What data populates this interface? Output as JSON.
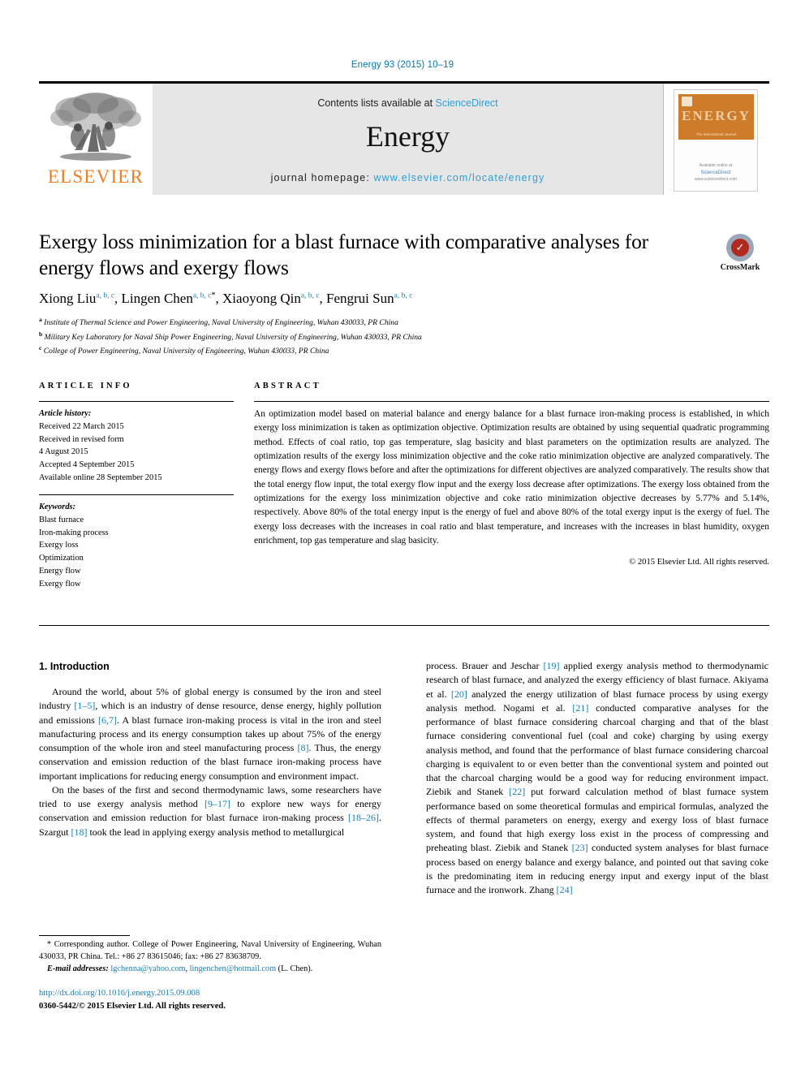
{
  "running_head": "Energy 93 (2015) 10–19",
  "masthead": {
    "publisher_name": "ELSEVIER",
    "contents_prefix": "Contents lists available at ",
    "contents_link": "ScienceDirect",
    "journal_title": "Energy",
    "homepage_prefix": "journal homepage: ",
    "homepage_url": "www.elsevier.com/locate/energy",
    "cover": {
      "title": "ENERGY",
      "subtitle": "The International Journal",
      "footer_line1": "Available online at",
      "footer_line2": "ScienceDirect",
      "footer_line3": "www.sciencedirect.com"
    }
  },
  "article": {
    "title": "Exergy loss minimization for a blast furnace with comparative analyses for energy flows and exergy flows",
    "authors": [
      {
        "name": "Xiong Liu",
        "marks": "a, b, c",
        "corresponding": false
      },
      {
        "name": "Lingen Chen",
        "marks": "a, b, c",
        "corresponding": true
      },
      {
        "name": "Xiaoyong Qin",
        "marks": "a, b, c",
        "corresponding": false
      },
      {
        "name": "Fengrui Sun",
        "marks": "a, b, c",
        "corresponding": false
      }
    ],
    "affiliations": [
      {
        "mark": "a",
        "text": "Institute of Thermal Science and Power Engineering, Naval University of Engineering, Wuhan 430033, PR China"
      },
      {
        "mark": "b",
        "text": "Military Key Laboratory for Naval Ship Power Engineering, Naval University of Engineering, Wuhan 430033, PR China"
      },
      {
        "mark": "c",
        "text": "College of Power Engineering, Naval University of Engineering, Wuhan 430033, PR China"
      }
    ]
  },
  "crossmark": {
    "label": "CrossMark"
  },
  "sections": {
    "article_info_header": "ARTICLE INFO",
    "abstract_header": "ABSTRACT"
  },
  "article_info": {
    "history_label": "Article history:",
    "history": [
      "Received 22 March 2015",
      "Received in revised form",
      "4 August 2015",
      "Accepted 4 September 2015",
      "Available online 28 September 2015"
    ],
    "keywords_label": "Keywords:",
    "keywords": [
      "Blast furnace",
      "Iron-making process",
      "Exergy loss",
      "Optimization",
      "Energy flow",
      "Exergy flow"
    ]
  },
  "abstract": {
    "text": "An optimization model based on material balance and energy balance for a blast furnace iron-making process is established, in which exergy loss minimization is taken as optimization objective. Optimization results are obtained by using sequential quadratic programming method. Effects of coal ratio, top gas temperature, slag basicity and blast parameters on the optimization results are analyzed. The optimization results of the exergy loss minimization objective and the coke ratio minimization objective are analyzed comparatively. The energy flows and exergy flows before and after the optimizations for different objectives are analyzed comparatively. The results show that the total energy flow input, the total exergy flow input and the exergy loss decrease after optimizations. The exergy loss obtained from the optimizations for the exergy loss minimization objective and coke ratio minimization objective decreases by 5.77% and 5.14%, respectively. Above 80% of the total energy input is the energy of fuel and above 80% of the total exergy input is the exergy of fuel. The exergy loss decreases with the increases in coal ratio and blast temperature, and increases with the increases in blast humidity, oxygen enrichment, top gas temperature and slag basicity.",
    "copyright": "© 2015 Elsevier Ltd. All rights reserved."
  },
  "body": {
    "section_number_title": "1. Introduction",
    "left_paragraph_1": {
      "part1": "Around the world, about 5% of global energy is consumed by the iron and steel industry ",
      "ref1": "[1–5]",
      "part2": ", which is an industry of dense resource, dense energy, highly pollution and emissions ",
      "ref2": "[6,7]",
      "part3": ". A blast furnace iron-making process is vital in the iron and steel manufacturing process and its energy consumption takes up about 75% of the energy consumption of the whole iron and steel manufacturing process ",
      "ref3": "[8]",
      "part4": ". Thus, the energy conservation and emission reduction of the blast furnace iron-making process have important implications for reducing energy consumption and environment impact."
    },
    "left_paragraph_2": {
      "part1": "On the bases of the first and second thermodynamic laws, some researchers have tried to use exergy analysis method ",
      "ref1": "[9–17]",
      "part2": " to explore new ways for energy conservation and emission reduction for blast furnace iron-making process ",
      "ref2": "[18–26]",
      "part3": ". Szargut ",
      "ref3": "[18]",
      "part4": " took the lead in applying exergy analysis method to metallurgical"
    },
    "right_paragraph": {
      "part1": "process. Brauer and Jeschar ",
      "ref1": "[19]",
      "part2": " applied exergy analysis method to thermodynamic research of blast furnace, and analyzed the exergy efficiency of blast furnace. Akiyama et al. ",
      "ref2": "[20]",
      "part3": " analyzed the energy utilization of blast furnace process by using exergy analysis method. Nogami et al. ",
      "ref3": "[21]",
      "part4": " conducted comparative analyses for the performance of blast furnace considering charcoal charging and that of the blast furnace considering conventional fuel (coal and coke) charging by using exergy analysis method, and found that the performance of blast furnace considering charcoal charging is equivalent to or even better than the conventional system and pointed out that the charcoal charging would be a good way for reducing environment impact. Ziebik and Stanek ",
      "ref4": "[22]",
      "part5": " put forward calculation method of blast furnace system performance based on some theoretical formulas and empirical formulas, analyzed the effects of thermal parameters on energy, exergy and exergy loss of blast furnace system, and found that high exergy loss exist in the process of compressing and preheating blast. Ziebik and Stanek ",
      "ref5": "[23]",
      "part6": " conducted system analyses for blast furnace process based on energy balance and exergy balance, and pointed out that saving coke is the predominating item in reducing energy input and exergy input of the blast furnace and the ironwork. Zhang ",
      "ref6": "[24]"
    }
  },
  "footnote": {
    "star": "*",
    "text": " Corresponding author. College of Power Engineering, Naval University of Engineering, Wuhan 430033, PR China. Tel.: +86 27 83615046; fax: +86 27 83638709.",
    "email_label": "E-mail addresses:",
    "email1": "lgchenna@yahoo.com",
    "email_sep": ", ",
    "email2": "lingenchen@hotmail.com",
    "email_suffix": " (L. Chen)."
  },
  "footer": {
    "doi": "http://dx.doi.org/10.1016/j.energy.2015.09.008",
    "issn_line": "0360-5442/© 2015 Elsevier Ltd. All rights reserved."
  },
  "colors": {
    "link_blue": "#1a7fb5",
    "sciencedirect_blue": "#2e9fd4",
    "elsevier_orange": "#f07d20",
    "cover_orange": "#cf7c2a",
    "masthead_gray": "#e6e6e6"
  }
}
